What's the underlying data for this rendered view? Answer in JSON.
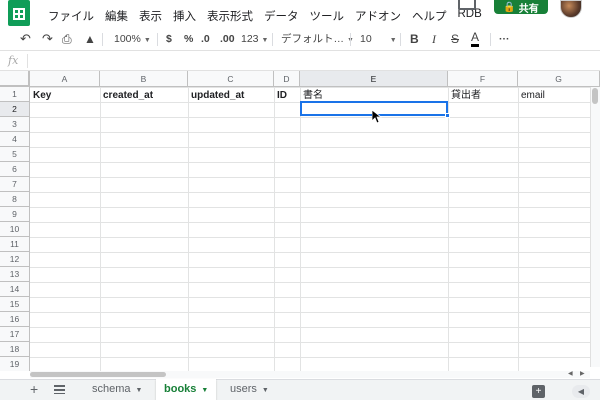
{
  "menu": {
    "items": [
      "ファイル",
      "編集",
      "表示",
      "挿入",
      "表示形式",
      "データ",
      "ツール",
      "アドオン",
      "ヘルプ",
      "RDB"
    ],
    "share_label": "共有"
  },
  "toolbar": {
    "zoom": "100%",
    "currency": "$",
    "percent": "%",
    "dec_decrease": ".0",
    "dec_increase": ".00",
    "more_formats": "123",
    "font": "デフォルト…",
    "font_size": "10",
    "bold": "B",
    "italic": "I",
    "strike": "S",
    "text_color": "A",
    "more": "···"
  },
  "formula_bar": {
    "fx": "fx",
    "value": ""
  },
  "columns": [
    "A",
    "B",
    "C",
    "D",
    "E",
    "F",
    "G"
  ],
  "rows": [
    "1",
    "2",
    "3",
    "4",
    "5",
    "6",
    "7",
    "8",
    "9",
    "10",
    "11",
    "12",
    "13",
    "14",
    "15",
    "16",
    "17",
    "18",
    "19"
  ],
  "header_row": [
    "Key",
    "created_at",
    "updated_at",
    "ID",
    "書名",
    "貸出者",
    "email"
  ],
  "selected_cell": "E2",
  "sheets": [
    {
      "name": "schema",
      "active": false
    },
    {
      "name": "books",
      "active": true
    },
    {
      "name": "users",
      "active": false
    }
  ],
  "colors": {
    "brand": "#0f9d58",
    "share": "#188038",
    "selection": "#1a73e8",
    "active_tab": "#188038"
  }
}
